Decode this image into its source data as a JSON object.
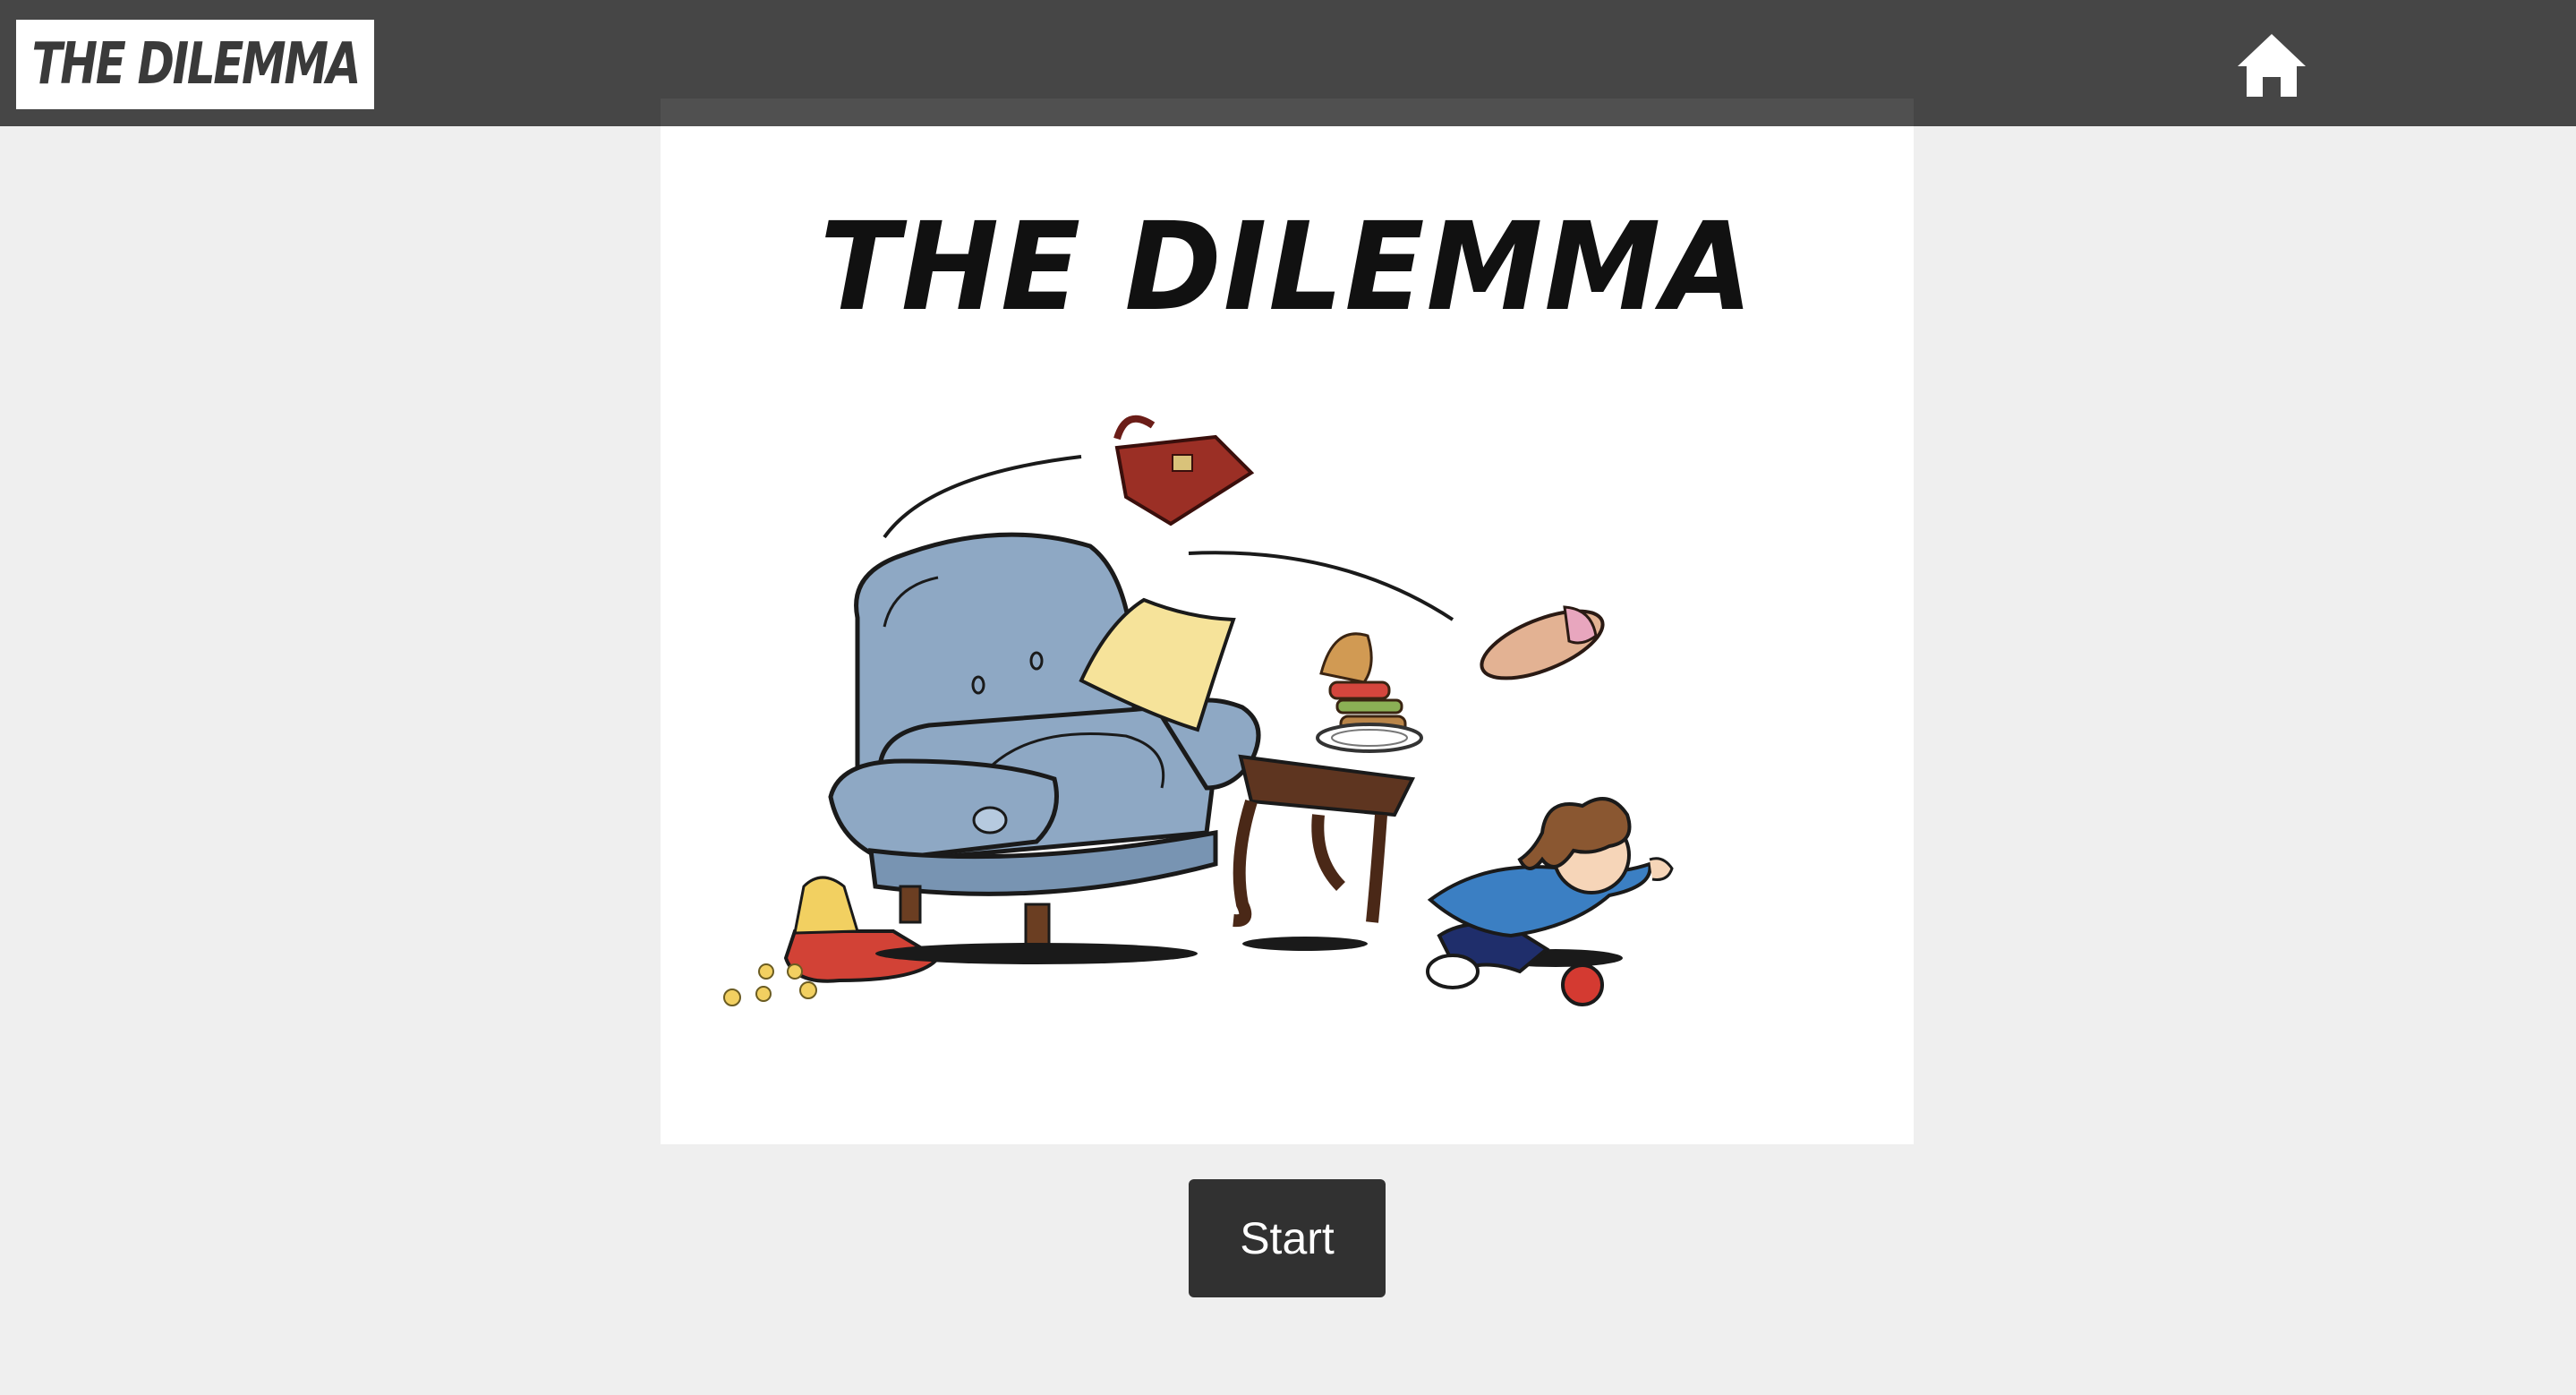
{
  "header": {
    "logo_text": "THE DILEMMA",
    "home_icon": "home-icon",
    "background_color": "#464646"
  },
  "main": {
    "comic_title": "THE DILEMMA",
    "start_label": "Start"
  },
  "colors": {
    "page_background": "#efefef",
    "button_background": "#313131",
    "button_text": "#ffffff"
  }
}
